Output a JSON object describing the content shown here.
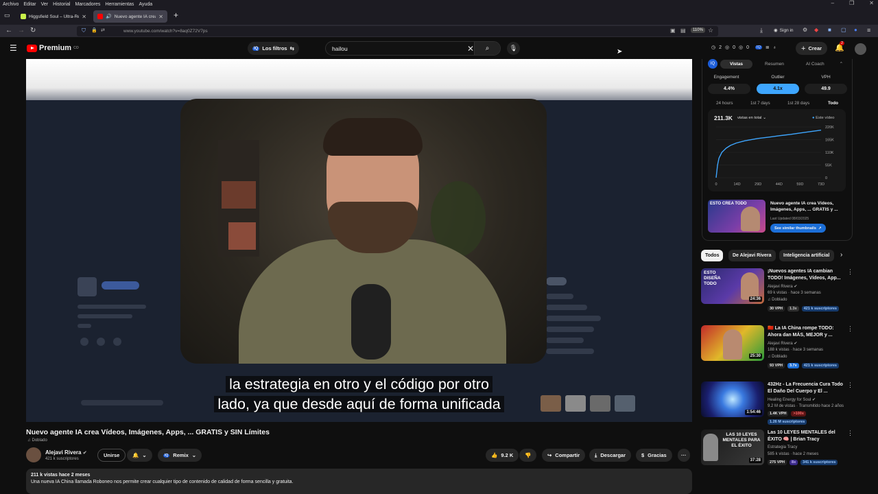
{
  "os_menu": [
    "Archivo",
    "Editar",
    "Ver",
    "Historial",
    "Marcadores",
    "Herramientas",
    "Ayuda"
  ],
  "window_controls": [
    "–",
    "❐",
    "✕"
  ],
  "browser": {
    "tabs": [
      {
        "label": "Higgsfield Soul – Ultra-Realistic",
        "active": false
      },
      {
        "label": "Nuevo agente IA crea Víde",
        "active": true
      }
    ],
    "new_tab": "+",
    "url": "www.youtube.com/watch?v=8aq0Z72V7ps",
    "zoom": "110%",
    "sign_in": "Sign in"
  },
  "yt_header": {
    "brand": "Premium",
    "brand_sup": "CO",
    "filters_label": "Los filtros",
    "search_value": "hailou",
    "stats": [
      "2",
      "0",
      "0"
    ],
    "create_label": "Crear",
    "notif_count": "2"
  },
  "video": {
    "subtitle_line1": "la estrategia en otro y el código por otro",
    "subtitle_line2": "lado, ya que desde aquí de forma unificada",
    "title": "Nuevo agente IA crea Vídeos, Imágenes, Apps, ... GRATIS y SIN Límites",
    "dubbed": "Doblado",
    "channel": "Alejavi Rivera",
    "subscribers": "421 k suscriptores",
    "join_label": "Unirse",
    "remix_label": "Remix",
    "likes": "9.2 K",
    "share_label": "Compartir",
    "download_label": "Descargar",
    "thanks_label": "Gracias",
    "more": "···",
    "views_date": "211 k vistas  hace 2 meses",
    "description": "Una nueva IA China llamada Roboneo nos permite crear cualquier tipo de contenido de calidad de forma sencilla y gratuita."
  },
  "panel": {
    "logo": "IQ",
    "tabs": [
      "Vistas",
      "Resumen",
      "AI Coach"
    ],
    "active_tab": "Vistas",
    "metrics": [
      {
        "label": "Engagement",
        "value": "4.4%"
      },
      {
        "label": "Outlier",
        "value": "4.1x"
      },
      {
        "label": "VPH",
        "value": "49.9"
      }
    ],
    "ranges": [
      "24 hours",
      "1st 7 days",
      "1st 28 days",
      "Todo"
    ],
    "active_range": "Todo",
    "total_views": "211.3K",
    "total_views_label": "vistas en total",
    "legend_label": "Este vídeo",
    "thumb_card": {
      "thumb_text": "ESTO CREA TODO",
      "title": "Nuevo agente IA crea Vídeos, Imágenes, Apps, ... GRATIS y ...",
      "updated": "Last Updated 08/03/2025",
      "button": "See similar thumbnails"
    }
  },
  "chart_data": {
    "type": "line",
    "x_ticks": [
      "0",
      "14D",
      "29D",
      "44D",
      "59D",
      "73D"
    ],
    "y_ticks": [
      "220K",
      "165K",
      "110K",
      "55K",
      "0"
    ],
    "ylim": [
      0,
      220000
    ],
    "x": [
      0,
      1,
      2,
      4,
      7,
      10,
      14,
      20,
      29,
      37,
      44,
      52,
      59,
      66,
      73
    ],
    "series": [
      {
        "name": "Este vídeo",
        "color": "#3ea6ff",
        "values": [
          0,
          55000,
          85000,
          110000,
          128000,
          140000,
          150000,
          160000,
          170000,
          176000,
          182000,
          188000,
          194000,
          200000,
          206000
        ]
      }
    ]
  },
  "chips": [
    "Todos",
    "De Alejavi Rivera",
    "Inteligencia artificial"
  ],
  "recommendations": [
    {
      "title": "¡Nuevos agentes IA cambian TODO! Imágenes, Vídeos, App...",
      "channel": "Alejavi Rivera",
      "meta": "69 k vistas · hace 3 semanas",
      "dubbed": "Doblado",
      "duration": "24:36",
      "thumb_text": "ESTO DISEÑA TODO",
      "badges": [
        "30 VPH",
        "1.3x",
        "421 k suscriptores"
      ]
    },
    {
      "title": "🇨🇳 La IA China rompe TODO: Ahora dan MÁS, MEJOR y ...",
      "channel": "Alejavi Rivera",
      "meta": "188 k vistas · hace 3 semanas",
      "dubbed": "Doblado",
      "duration": "25:30",
      "thumb_text": "",
      "badges": [
        "93 VPH",
        "3.7x",
        "421 k suscriptores"
      ]
    },
    {
      "title": "432Hz - La Frecuencia Cura Todo El Daño Del Cuerpo y El ...",
      "channel": "Healing Energy for Soul",
      "meta": "9.2 M de vistas · Transmitido hace 2 años",
      "dubbed": "",
      "duration": "1:54:46",
      "thumb_text": "",
      "badges": [
        "1.4K VPH",
        ">100x",
        "1.26 M suscriptores"
      ]
    },
    {
      "title": "Las 10 LEYES MENTALES del ÉXITO 🧠 | Brian Tracy",
      "channel": "Estrategia Tracy",
      "meta": "585 k vistas · hace 2 meses",
      "dubbed": "",
      "duration": "37:28",
      "thumb_text": "LAS 10 LEYES MENTALES PARA EL ÉXITO",
      "badges": [
        "275 VPH",
        "8x",
        "341 k suscriptores"
      ]
    }
  ]
}
